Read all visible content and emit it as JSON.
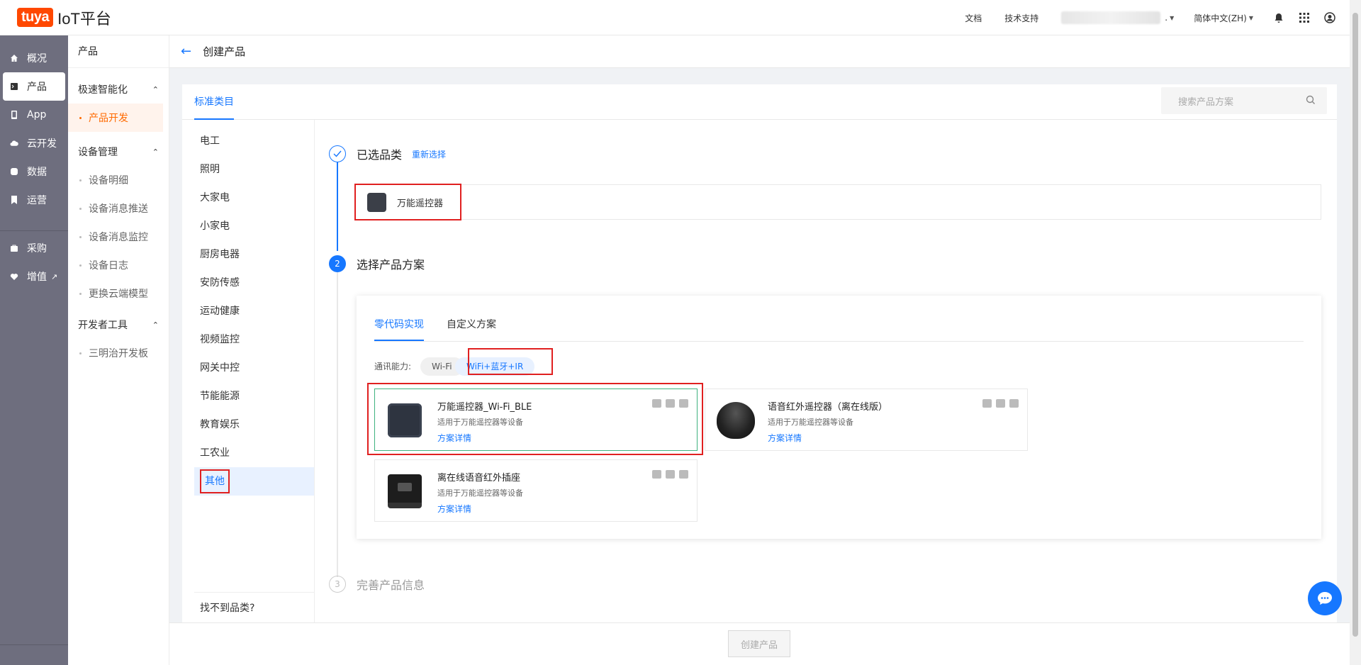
{
  "topbar": {
    "logo": "tuya",
    "platform": "IoT平台",
    "docs": "文档",
    "support": "技术支持",
    "language": "简体中文(ZH)"
  },
  "sidebar": {
    "items": [
      {
        "label": "概况",
        "icon": "home-icon"
      },
      {
        "label": "产品",
        "icon": "product-icon"
      },
      {
        "label": "App",
        "icon": "phone-icon"
      },
      {
        "label": "云开发",
        "icon": "cloud-icon"
      },
      {
        "label": "数据",
        "icon": "data-icon"
      },
      {
        "label": "运营",
        "icon": "bookmark-icon"
      },
      {
        "label": "采购",
        "icon": "purchase-icon"
      },
      {
        "label": "增值",
        "icon": "heart-icon"
      }
    ]
  },
  "subnav": {
    "title": "产品",
    "groups": [
      {
        "label": "极速智能化",
        "items": [
          "产品开发"
        ]
      },
      {
        "label": "设备管理",
        "items": [
          "设备明细",
          "设备消息推送",
          "设备消息监控",
          "设备日志",
          "更换云端模型"
        ]
      },
      {
        "label": "开发者工具",
        "items": [
          "三明治开发板"
        ]
      }
    ]
  },
  "page": {
    "title": "创建产品"
  },
  "tabs": {
    "standard": "标准类目"
  },
  "search": {
    "placeholder": "搜索产品方案"
  },
  "categories": [
    "电工",
    "照明",
    "大家电",
    "小家电",
    "厨房电器",
    "安防传感",
    "运动健康",
    "视频监控",
    "网关中控",
    "节能能源",
    "教育娱乐",
    "工农业",
    "其他"
  ],
  "cant_find": "找不到品类?",
  "steps": {
    "s1": {
      "title": "已选品类",
      "reselect": "重新选择",
      "selected": "万能遥控器"
    },
    "s2": {
      "num": "2",
      "title": "选择产品方案"
    },
    "s3": {
      "num": "3",
      "title": "完善产品信息"
    }
  },
  "solution_tabs": {
    "zero_code": "零代码实现",
    "custom": "自定义方案"
  },
  "comm": {
    "label": "通讯能力:",
    "options": [
      "Wi-Fi",
      "WiFi+蓝牙+IR"
    ]
  },
  "products": [
    {
      "name": "万能遥控器_Wi-Fi_BLE",
      "desc": "适用于万能遥控器等设备",
      "link": "方案详情"
    },
    {
      "name": "语音红外遥控器（离在线版）",
      "desc": "适用于万能遥控器等设备",
      "link": "方案详情"
    },
    {
      "name": "离在线语音红外插座",
      "desc": "适用于万能遥控器等设备",
      "link": "方案详情"
    }
  ],
  "footer": {
    "create": "创建产品"
  },
  "colors": {
    "accent": "#1677ff",
    "brand": "#ff4800",
    "highlight": "#e02020"
  }
}
